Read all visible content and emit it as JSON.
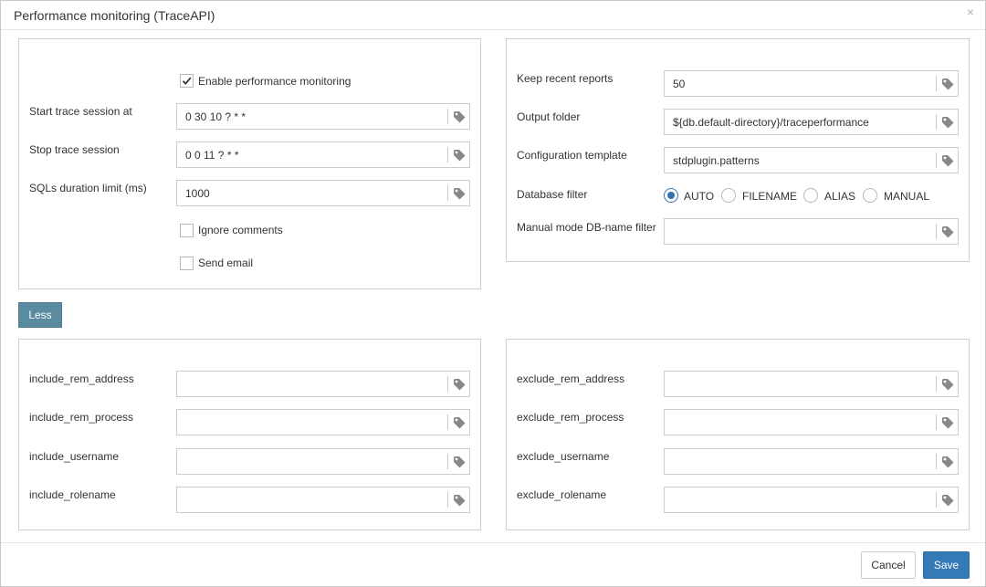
{
  "dialog": {
    "title": "Performance monitoring (TraceAPI)",
    "close_icon": "×"
  },
  "left_panel": {
    "enable_monitoring": {
      "label": "Enable performance monitoring",
      "checked": true
    },
    "start_trace": {
      "label": "Start trace session at",
      "value": "0 30 10 ? * *"
    },
    "stop_trace": {
      "label": "Stop trace session",
      "value": "0 0 11 ? * *"
    },
    "sql_duration": {
      "label": "SQLs duration limit (ms)",
      "value": "1000"
    },
    "ignore_comments": {
      "label": "Ignore comments",
      "checked": false
    },
    "send_email": {
      "label": "Send email",
      "checked": false
    }
  },
  "right_panel": {
    "keep_reports": {
      "label": "Keep recent reports",
      "value": "50"
    },
    "output_folder": {
      "label": "Output folder",
      "value": "${db.default-directory}/traceperformance"
    },
    "config_template": {
      "label": "Configuration template",
      "value": "stdplugin.patterns"
    },
    "database_filter": {
      "label": "Database filter",
      "options": [
        "AUTO",
        "FILENAME",
        "ALIAS",
        "MANUAL"
      ],
      "selected": "AUTO"
    },
    "manual_filter": {
      "label": "Manual mode DB-name filter",
      "value": ""
    }
  },
  "less_button": "Less",
  "include_panel": {
    "rem_address": {
      "label": "include_rem_address",
      "value": ""
    },
    "rem_process": {
      "label": "include_rem_process",
      "value": ""
    },
    "username": {
      "label": "include_username",
      "value": ""
    },
    "rolename": {
      "label": "include_rolename",
      "value": ""
    }
  },
  "exclude_panel": {
    "rem_address": {
      "label": "exclude_rem_address",
      "value": ""
    },
    "rem_process": {
      "label": "exclude_rem_process",
      "value": ""
    },
    "username": {
      "label": "exclude_username",
      "value": ""
    },
    "rolename": {
      "label": "exclude_rolename",
      "value": ""
    }
  },
  "footer": {
    "cancel_label": "Cancel",
    "save_label": "Save"
  },
  "icons": {
    "field_tag": "tag-icon",
    "checkbox_mark": "checkmark-icon"
  },
  "colors": {
    "save_button": "#337ab7",
    "less_button": "#5a8ba0",
    "radio_selected": "#3470b4"
  }
}
